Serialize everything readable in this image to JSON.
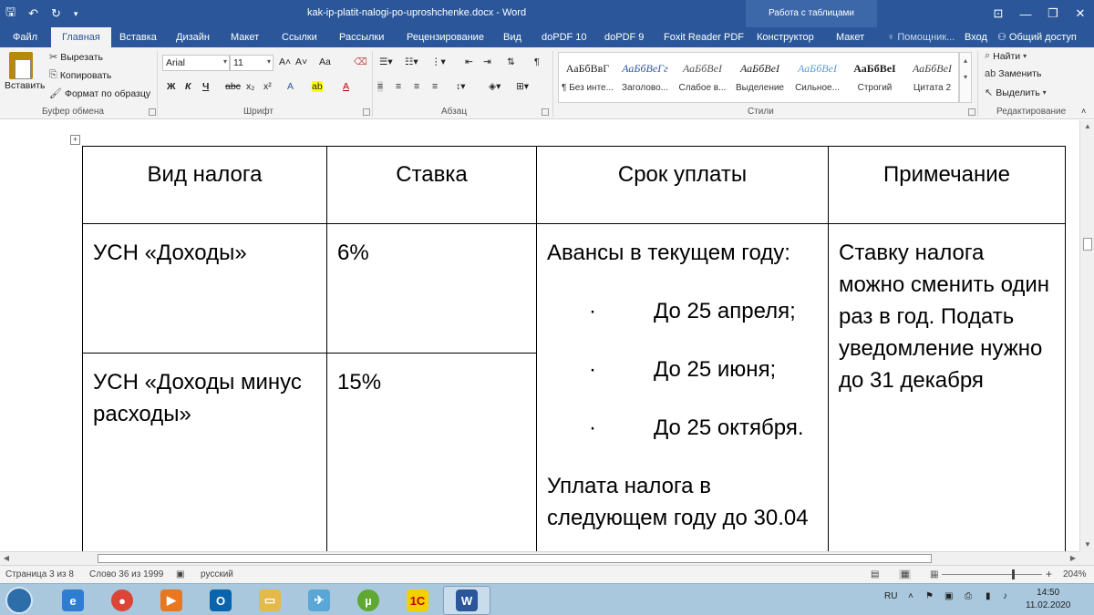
{
  "titlebar": {
    "doc_title": "kak-ip-platit-nalogi-po-uproshchenke.docx - Word",
    "context_tools": "Работа с таблицами"
  },
  "tabs": {
    "file": "Файл",
    "home": "Главная",
    "insert": "Вставка",
    "design": "Дизайн",
    "layout": "Макет",
    "references": "Ссылки",
    "mailings": "Рассылки",
    "review": "Рецензирование",
    "view": "Вид",
    "dopdf10": "doPDF 10",
    "dopdf9": "doPDF 9",
    "foxit": "Foxit Reader PDF",
    "constructor": "Конструктор",
    "table_layout": "Макет",
    "tell_me": "Помощник...",
    "sign_in": "Вход",
    "share": "Общий доступ"
  },
  "clipboard": {
    "paste": "Вставить",
    "cut": "Вырезать",
    "copy": "Копировать",
    "format_painter": "Формат по образцу",
    "group": "Буфер обмена"
  },
  "font": {
    "name": "Arial",
    "size": "11",
    "group": "Шрифт",
    "bold": "Ж",
    "italic": "К",
    "underline": "Ч",
    "strike": "abc",
    "sub": "x₂",
    "sup": "x²",
    "grow": "A˄",
    "shrink": "A˅",
    "case": "Aa"
  },
  "paragraph": {
    "group": "Абзац"
  },
  "styles": {
    "group": "Стили",
    "items": [
      {
        "sample": "АаБбВвГ",
        "name": "¶ Без инте..."
      },
      {
        "sample": "АаБбВеГг",
        "name": "Заголово..."
      },
      {
        "sample": "АаБбВеI",
        "name": "Слабое в..."
      },
      {
        "sample": "АаБбВеI",
        "name": "Выделение"
      },
      {
        "sample": "АаБбВеI",
        "name": "Сильное..."
      },
      {
        "sample": "АаБбВеI",
        "name": "Строгий"
      },
      {
        "sample": "АаБбВеI",
        "name": "Цитата 2"
      }
    ]
  },
  "editing": {
    "group": "Редактирование",
    "find": "Найти",
    "replace": "Заменить",
    "select": "Выделить"
  },
  "table": {
    "headers": [
      "Вид налога",
      "Ставка",
      "Срок уплаты",
      "Примечание"
    ],
    "row1": {
      "type": "УСН «Доходы»",
      "rate": "6%"
    },
    "row2": {
      "type": "УСН «Доходы минус расходы»",
      "rate": "15%"
    },
    "term": {
      "intro": "Авансы в текущем году:",
      "bullets": [
        "До 25 апреля;",
        "До 25 июня;",
        "До 25 октября."
      ],
      "bullet_mark": "·",
      "outro": "Уплата налога в следующем году до 30.04"
    },
    "note": "Ставку налога можно сменить один раз в год. Подать уведомление нужно до 31 декабря"
  },
  "statusbar": {
    "page": "Страница 3 из 8",
    "words": "Слово 36 из 1999",
    "language": "русский",
    "zoom": "204%"
  },
  "taskbar": {
    "lang": "RU",
    "time": "14:50",
    "date": "11.02.2020"
  }
}
